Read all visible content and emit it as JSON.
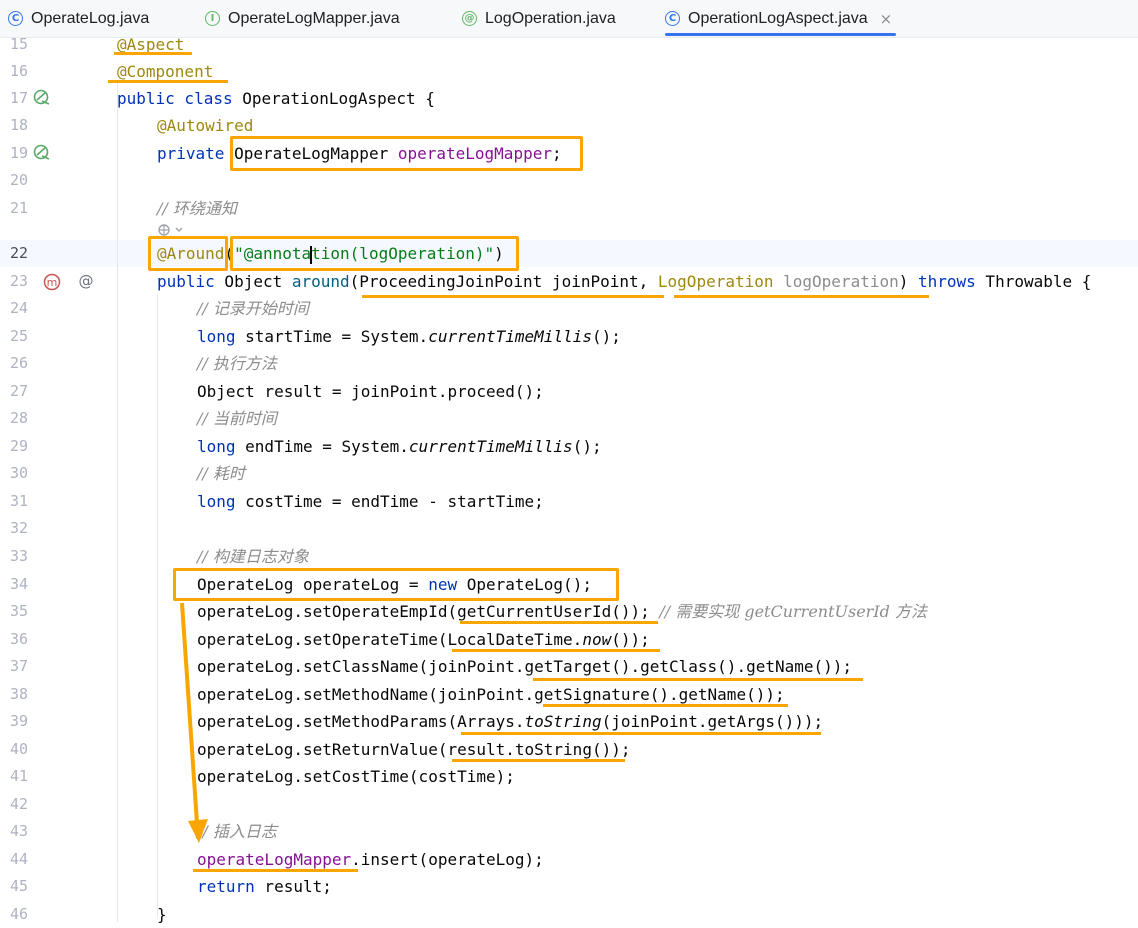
{
  "tabs": [
    {
      "label": "OperateLog.java",
      "icon": "class-icon",
      "icon_char": "C"
    },
    {
      "label": "OperateLogMapper.java",
      "icon": "interface-icon",
      "icon_char": "I"
    },
    {
      "label": "LogOperation.java",
      "icon": "annotation-icon",
      "icon_char": "@"
    },
    {
      "label": "OperationLogAspect.java",
      "icon": "class-icon",
      "icon_char": "C",
      "active": true,
      "close": "×"
    }
  ],
  "line_numbers": [
    "15",
    "16",
    "17",
    "18",
    "19",
    "20",
    "21",
    "22",
    "23",
    "24",
    "25",
    "26",
    "27",
    "28",
    "29",
    "30",
    "31",
    "32",
    "33",
    "34",
    "35",
    "36",
    "37",
    "38",
    "39",
    "40",
    "41",
    "42",
    "43",
    "44",
    "45",
    "46"
  ],
  "code": {
    "l15": "@Aspect",
    "l16": "@Component",
    "l17_kw": "public class",
    "l17_rest": " OperationLogAspect {",
    "l18": "@Autowired",
    "l19_kw": "private",
    "l19_type": "OperateLogMapper",
    "l19_fld": "operateLogMapper",
    "l19_end": ";",
    "l21": "// 环绕通知",
    "l22_ann": "@Around",
    "l22_str_a": "\"@annota",
    "l22_str_b": "tion(logOperation)\"",
    "l22_end": ")",
    "l23_kw": "public",
    "l23_a": " Object ",
    "l23_fn": "around",
    "l23_b": "(ProceedingJoinPoint joinPoint, ",
    "l23_ann": "LogOperation",
    "l23_unused": " logOperation",
    "l23_c": ") ",
    "l23_kw2": "throws",
    "l23_d": " Throwable {",
    "l24": "// 记录开始时间",
    "l25_kw": "long",
    "l25_a": " startTime = System.",
    "l25_it": "currentTimeMillis",
    "l25_b": "();",
    "l26": "// 执行方法",
    "l27": "Object result = joinPoint.proceed();",
    "l28": "// 当前时间",
    "l29_kw": "long",
    "l29_a": " endTime = System.",
    "l29_it": "currentTimeMillis",
    "l29_b": "();",
    "l30": "// 耗时",
    "l31_kw": "long",
    "l31_a": " costTime = endTime - startTime;",
    "l33": "// 构建日志对象",
    "l34_a": "OperateLog operateLog = ",
    "l34_kw": "new",
    "l34_b": " OperateLog();",
    "l35_a": "operateLog.setOperateEmpId(getCurrentUserId()); ",
    "l35_cmt": "// 需要实现 getCurrentUserId 方法",
    "l36_a": "operateLog.setOperateTime(LocalDateTime.",
    "l36_it": "now",
    "l36_b": "());",
    "l37": "operateLog.setClassName(joinPoint.getTarget().getClass().getName());",
    "l38": "operateLog.setMethodName(joinPoint.getSignature().getName());",
    "l39_a": "operateLog.setMethodParams(Arrays.",
    "l39_it": "toString",
    "l39_b": "(joinPoint.getArgs()));",
    "l40": "operateLog.setReturnValue(result.toString());",
    "l41": "operateLog.setCostTime(costTime);",
    "l43": "// 插入日志",
    "l44_fld": "operateLogMapper",
    "l44_a": ".insert(operateLog);",
    "l45_kw": "return",
    "l45_a": " result;",
    "l46": "}"
  },
  "colors": {
    "highlight": "#f9a602",
    "keyword": "#0033b3",
    "annotation": "#9e880d",
    "string": "#067d17",
    "field": "#871094"
  }
}
